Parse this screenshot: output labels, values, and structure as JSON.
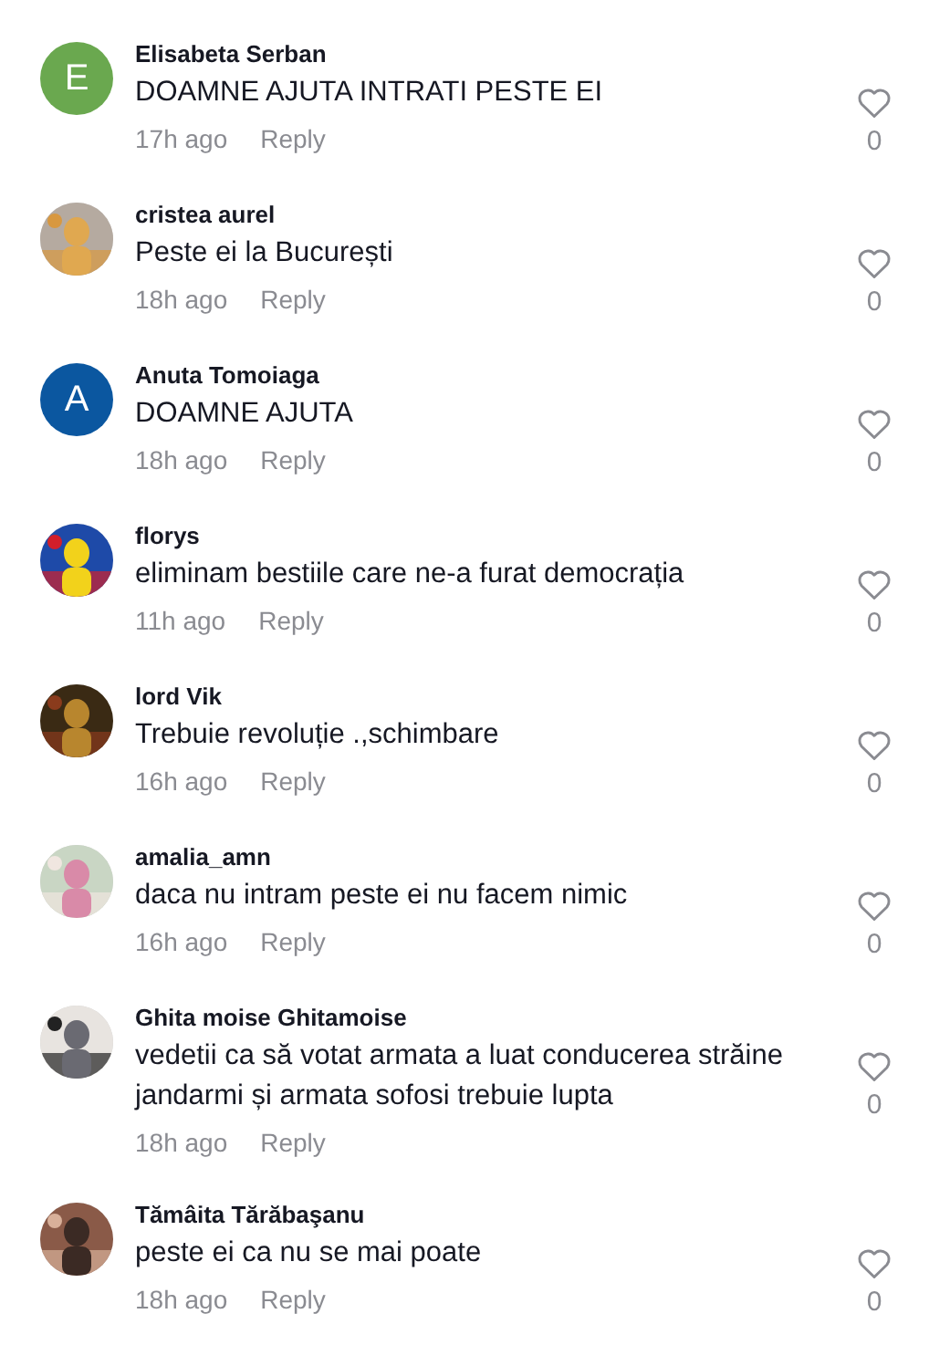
{
  "comments": [
    {
      "author": "Elisabeta Serban",
      "text": "DOAMNE AJUTA INTRATI PESTE EI",
      "time": "17h ago",
      "reply": "Reply",
      "likes": "0",
      "liked": false,
      "avatar": {
        "kind": "letter",
        "letter": "E",
        "color": "#6aa84f"
      }
    },
    {
      "author": "cristea aurel",
      "text": "Peste ei la București",
      "time": "18h ago",
      "reply": "Reply",
      "likes": "0",
      "liked": false
    },
    {
      "author": "Anuta Tomoiaga",
      "text": "DOAMNE AJUTA",
      "time": "18h ago",
      "reply": "Reply",
      "likes": "0",
      "liked": false,
      "avatar": {
        "kind": "letter",
        "letter": "A",
        "color": "#0b57a0"
      }
    },
    {
      "author": "florys",
      "text": "eliminam bestiile care ne-a furat democrația",
      "time": "11h ago",
      "reply": "Reply",
      "likes": "0",
      "liked": false
    },
    {
      "author": "lord Vik",
      "text": "Trebuie revoluție .,schimbare",
      "time": "16h ago",
      "reply": "Reply",
      "likes": "0",
      "liked": false
    },
    {
      "author": "amalia_amn",
      "text": "daca nu intram peste ei nu facem nimic",
      "time": "16h ago",
      "reply": "Reply",
      "likes": "0",
      "liked": false
    },
    {
      "author": "Ghita moise Ghitamoise",
      "text": "vedetii ca să votat armata a luat conducerea străine jandarmi și armata sofosi trebuie lupta",
      "time": "18h ago",
      "reply": "Reply",
      "likes": "0",
      "liked": false
    },
    {
      "author": "Tămâita Tărăbaşanu",
      "text": "peste ei ca nu se mai poate",
      "time": "18h ago",
      "reply": "Reply",
      "likes": "0",
      "liked": false
    }
  ]
}
